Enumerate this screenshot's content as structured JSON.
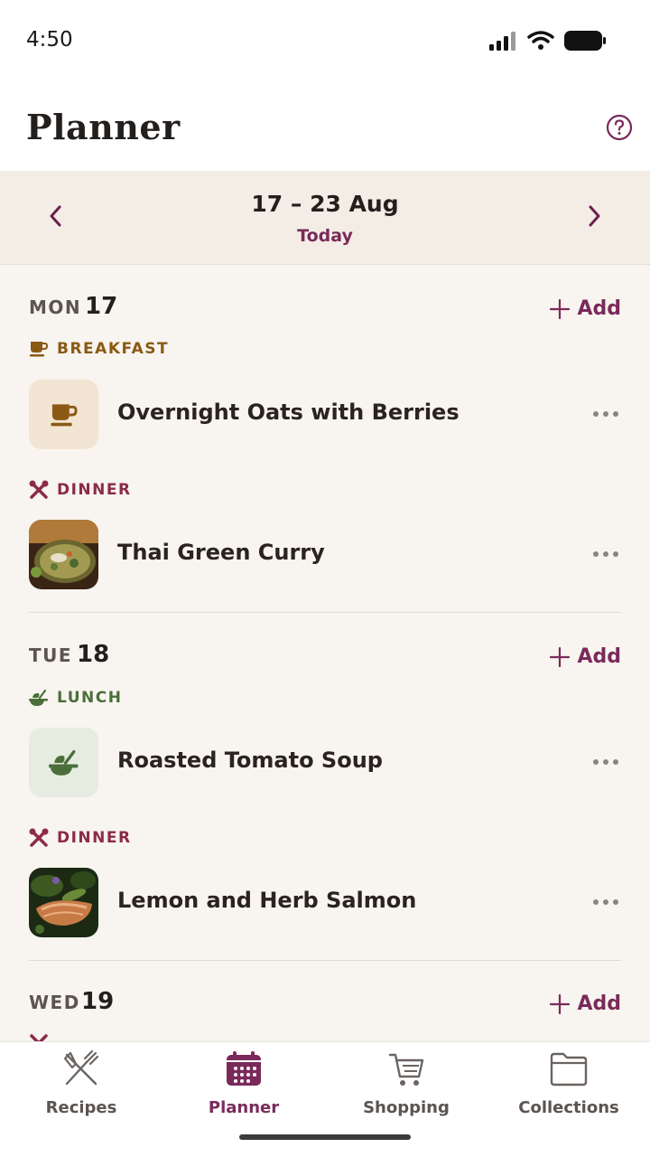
{
  "status_bar": {
    "time": "4:50"
  },
  "header": {
    "title": "Planner",
    "help_icon": "help-circle-icon"
  },
  "week": {
    "range": "17 – 23 Aug",
    "today_label": "Today"
  },
  "add_label": "Add",
  "colors": {
    "accent": "#7a2a5a",
    "breakfast": "#8a5a14",
    "lunch": "#4a6f3a",
    "dinner": "#8c2a4a",
    "background": "#f8f4ef"
  },
  "days": [
    {
      "name": "MON",
      "num": "17",
      "meals": [
        {
          "type": "BREAKFAST",
          "icon": "coffee-cup-icon",
          "title": "Overnight Oats with Berries"
        },
        {
          "type": "DINNER",
          "icon": "utensils-crossed-icon",
          "title": "Thai Green Curry"
        }
      ]
    },
    {
      "name": "TUE",
      "num": "18",
      "meals": [
        {
          "type": "LUNCH",
          "icon": "lunch-bowl-icon",
          "title": "Roasted Tomato Soup"
        },
        {
          "type": "DINNER",
          "icon": "utensils-crossed-icon",
          "title": "Lemon and Herb Salmon"
        }
      ]
    },
    {
      "name": "WED",
      "num": "19",
      "meals": []
    }
  ],
  "nav": [
    {
      "label": "Recipes",
      "icon": "fork-knife-icon",
      "active": false
    },
    {
      "label": "Planner",
      "icon": "calendar-icon",
      "active": true
    },
    {
      "label": "Shopping",
      "icon": "shopping-cart-icon",
      "active": false
    },
    {
      "label": "Collections",
      "icon": "folder-icon",
      "active": false
    }
  ]
}
